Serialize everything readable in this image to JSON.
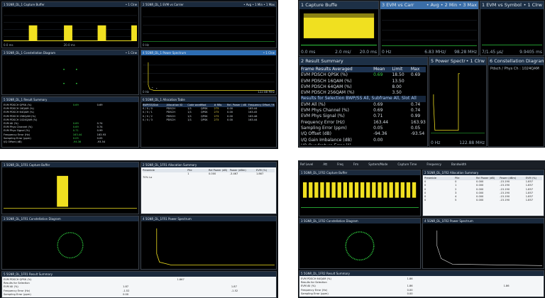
{
  "colors": {
    "trace_yellow": "#f0e020",
    "trace_green": "#30d040",
    "panel_bg": "#000000",
    "header_blue": "#2d6db3"
  },
  "q1": {
    "panels": {
      "capture": {
        "title": "1 5GNR_DL_1 Capture Buffer",
        "right": "• 1 Clrw",
        "xl": "0.0 ms",
        "xc": "20.0 ms"
      },
      "evm_carrier": {
        "title": "2 5GNR_DL_1 EVM vs Carrier",
        "right": "• Avg • 1 Min • 1 Max",
        "xl": "0 Hz",
        "xc": "",
        "xr": ""
      },
      "const_l": {
        "title": "3 5GNR_DL_1 Constellation Diagram",
        "right": "• 1 Clrw"
      },
      "power_spec": {
        "title": "4 5GNR_DL_1 Power Spectrum",
        "right": "• 1 Clrw",
        "xl": "0 Hz",
        "xr": "122.88 MHz"
      },
      "summary": {
        "title": "5 5GNR_DL_1 Result Summary",
        "right": "",
        "rows": [
          [
            "EVM PDSCH QPSK (%)",
            "0.69",
            "0.69",
            ""
          ],
          [
            "EVM PDSCH 16QAM (%)",
            "",
            "",
            ""
          ],
          [
            "EVM PDSCH 64QAM (%)",
            "",
            "",
            ""
          ],
          [
            "EVM PDSCH 256QAM (%)",
            "",
            "",
            ""
          ],
          [
            "EVM PDSCH 1024QAM (%)",
            "",
            "",
            ""
          ],
          [
            "EVM All (%)",
            "0.69",
            "0.74",
            ""
          ],
          [
            "EVM Phys Channel (%)",
            "0.69",
            "0.74",
            ""
          ],
          [
            "EVM Phys Signal (%)",
            "0.71",
            "0.99",
            ""
          ],
          [
            "Frequency Error (Hz)",
            "163.44",
            "163.93",
            ""
          ],
          [
            "Sampling Error (ppm)",
            "0.05",
            "0.05",
            ""
          ],
          [
            "I/Q Offset (dB)",
            "-94.36",
            "-93.54",
            ""
          ]
        ]
      },
      "alloc": {
        "title": "6 5GNR_DL_1 Allocation Table",
        "hdr": [
          "BWP/SS/Slot",
          "Allocation ID",
          "Code word",
          "Mod",
          "# RBs",
          "Rel. Power / dB",
          "Frequency Offset / Hz"
        ],
        "rows": [
          [
            "0 / 0 / 0",
            "PDSCH",
            "1/1",
            "QPSK",
            "273",
            "0.00",
            "163.44"
          ],
          [
            "0 / 0 / 1",
            "PDSCH",
            "1/1",
            "QPSK",
            "273",
            "0.00",
            "163.45"
          ],
          [
            "0 / 0 / 2",
            "PDSCH",
            "1/1",
            "QPSK",
            "273",
            "0.00",
            "163.46"
          ],
          [
            "0 / 0 / 3",
            "PDSCH",
            "1/1",
            "QPSK",
            "273",
            "0.00",
            "163.44"
          ]
        ]
      }
    }
  },
  "q2": {
    "tabs": {
      "capture": "1 Capture Buffe",
      "evm_carrier": "3 EVM vs Carr",
      "evm_carrier_r": "• Avg • 2 Min • 3 Max",
      "evm_symbol": "1 EVM vs Symbol",
      "evm_symbol_r": "• 1 Clrw"
    },
    "axis": {
      "a": "0.0 ms",
      "b": "2.0 ms/",
      "c": "20.0 ms",
      "d": "0 Hz",
      "e": "6.83 MHz/",
      "f": "98.28 MHz",
      "g": "7/1.45 μs/",
      "h": "9.9405 ms"
    },
    "summary": {
      "title": "2 Result Summary",
      "title_r": "",
      "hdr": [
        "Frame Results Averaged",
        "Mean",
        "Limit",
        "Max"
      ],
      "rows": [
        [
          "EVM PDSCH QPSK (%)",
          "0.69",
          "18.50",
          "0.69"
        ],
        [
          "EVM PDSCH 16QAM (%)",
          "",
          "13.50",
          ""
        ],
        [
          "EVM PDSCH 64QAM (%)",
          "",
          "8.00",
          ""
        ],
        [
          "EVM PDSCH 256QAM (%)",
          "",
          "3.50",
          ""
        ]
      ],
      "group": "Results for Selection  BWP/SS All, Subframe All, Slot All",
      "rows2": [
        [
          "EVM All (%)",
          "0.69",
          "",
          "0.74"
        ],
        [
          "EVM Phys Channel (%)",
          "0.69",
          "",
          "0.74"
        ],
        [
          "EVM Phys Signal (%)",
          "0.71",
          "",
          "0.99"
        ],
        [
          "Frequency Error (Hz)",
          "163.44",
          "",
          "163.93"
        ],
        [
          "Sampling Error (ppm)",
          "0.05",
          "",
          "0.05"
        ],
        [
          "I/Q Offset (dB)",
          "-94.36",
          "",
          "-93.54"
        ],
        [
          "I/Q Gain Imbalance (dB)",
          "0.00",
          "",
          ""
        ],
        [
          "I/Q Quadrature Error (°)",
          "",
          "",
          ""
        ],
        [
          "OSTP (dBm)",
          "-3.66",
          "",
          ""
        ],
        [
          "Power (dBm)",
          "-3.66",
          "",
          "-3.66"
        ],
        [
          "Crest Factor (dB)",
          "10.37",
          "",
          "10.38"
        ]
      ]
    },
    "power": {
      "title": "5 Power Spectr",
      "title_r": "• 1 Clrw",
      "xl": "0 Hz",
      "xr": "122.88 MHz"
    },
    "const": {
      "title": "6 Constellation Diagram",
      "sub": "Pdsch / Phys Ch : 1024QAM"
    }
  },
  "q3": {
    "panels": {
      "capture": {
        "title": "1 5GNR_DL_1FR1 Capture Buffer"
      },
      "alloc": {
        "title": "2 5GNR_DL_1FR1 Allocation Summary",
        "hdr": [
          "Preamble",
          "Pile",
          "Rel Power (dB)",
          "Power (dBm)",
          "EVM (%)"
        ],
        "rows": [
          [
            "",
            "1",
            "0.000",
            "-3.467",
            "1.867"
          ],
          [
            "70% Lo",
            "",
            "",
            "",
            ""
          ]
        ]
      },
      "const": {
        "title": "3 5GNR_DL_1FR1 Constellation Diagram"
      },
      "power": {
        "title": "4 5GNR_DL_1FR1 Power Spectrum"
      },
      "summary": {
        "title": "5 5GNR_DL_1FR1 Result Summary",
        "rows": [
          [
            "EVM PDSCH QPSK (%)",
            "",
            "1.867",
            ""
          ],
          [
            "Results for Selection",
            "",
            "",
            ""
          ],
          [
            "EVM All (%)",
            "1.87",
            "",
            "1.87"
          ],
          [
            "Frequency Error (Hz)",
            "-1.52",
            "",
            "-1.52"
          ],
          [
            "Sampling Error (ppm)",
            "0.00",
            "",
            ""
          ],
          [
            "Power (dBm)",
            "-3.46",
            "",
            "-3.46"
          ],
          [
            "Crest Factor (dB)",
            "11.50",
            "",
            ""
          ],
          [
            "I/Q Offset (dB)",
            "",
            "",
            ""
          ],
          [
            "I/Q Gain Imbalance (dB)",
            "",
            "",
            ""
          ],
          [
            "I/Q Quadrature Error (°)",
            "",
            "",
            ""
          ],
          [
            "Crest Factor (dB)",
            "3.48",
            "",
            "3.46"
          ]
        ]
      }
    }
  },
  "q4": {
    "toolbar": [
      "Ref Level",
      "Att",
      "Freq",
      "Frm",
      "System/Mode",
      "Capture Time",
      "Frequency",
      "Bandwidth"
    ],
    "panels": {
      "capture": {
        "title": "1 5GNR_DL_1FR2 Capture Buffer"
      },
      "alloc": {
        "title": "2 5GNR_DL_1FR2 Allocation Summary",
        "hdr": [
          "Preamble",
          "Pile",
          "Rel Power (dB)",
          "Power (dBm)",
          "EVM (%)"
        ],
        "rows": [
          [
            "0",
            "0",
            "0.000",
            "-15.190",
            "1.857"
          ],
          [
            "0",
            "1",
            "0.000",
            "-15.190",
            "1.857"
          ],
          [
            "0",
            "2",
            "0.000",
            "-15.190",
            "1.857"
          ],
          [
            "0",
            "3",
            "0.000",
            "-15.190",
            "1.857"
          ],
          [
            "0",
            "4",
            "0.000",
            "-15.190",
            "1.857"
          ],
          [
            "0",
            "5",
            "0.000",
            "-15.190",
            "1.857"
          ]
        ]
      },
      "const": {
        "title": "3 5GNR_DL_1FR2 Constellation Diagram"
      },
      "power": {
        "title": "4 5GNR_DL_1FR2 Power Spectrum"
      },
      "summary": {
        "title": "5 5GNR_DL_1FR2 Result Summary",
        "rows": [
          [
            "EVM PDSCH 64QAM (%)",
            "1.86",
            "",
            ""
          ],
          [
            "Results for Selection",
            "",
            "",
            ""
          ],
          [
            "EVM All (%)",
            "1.86",
            "",
            "1.86"
          ],
          [
            "Frequency Error (Hz)",
            "0.00",
            "",
            ""
          ],
          [
            "Sampling Error (ppm)",
            "0.00",
            "",
            ""
          ],
          [
            "I/Q Offset (dB)",
            "",
            "",
            ""
          ],
          [
            "I/Q Gain Imbalance (dB)",
            "",
            "",
            ""
          ],
          [
            "Power (dBm)",
            "-15.19",
            "",
            "-15.19"
          ]
        ]
      }
    }
  }
}
